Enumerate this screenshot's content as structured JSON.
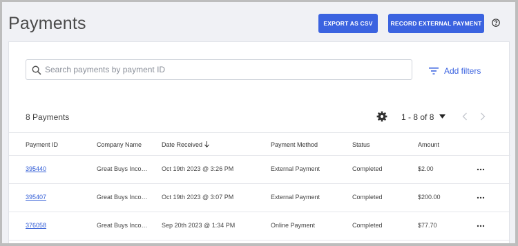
{
  "header": {
    "title": "Payments",
    "export_label": "EXPORT AS CSV",
    "record_label": "RECORD EXTERNAL PAYMENT",
    "help_icon": "help-circle-icon"
  },
  "colors": {
    "accent": "#3b63e0",
    "link": "#2f5bd6",
    "background": "#f0f1f5"
  },
  "search": {
    "placeholder": "Search payments by payment ID",
    "value": "",
    "icon": "search-icon"
  },
  "filters": {
    "label": "Add filters",
    "icon": "filter-icon"
  },
  "summary": {
    "count_label": "8 Payments"
  },
  "pager": {
    "range": "1 - 8 of 8",
    "settings_icon": "gear-icon",
    "prev_icon": "chevron-left-icon",
    "next_icon": "chevron-right-icon"
  },
  "table": {
    "columns": [
      "Payment ID",
      "Company Name",
      "Date Received",
      "Payment Method",
      "Status",
      "Amount"
    ],
    "sort_icon": "arrow-down-icon",
    "rows": [
      [
        "395440",
        "Great Buys Inco…",
        "Oct 19th 2023 @ 3:26 PM",
        "External Payment",
        "Completed",
        "$2.00"
      ],
      [
        "395407",
        "Great Buys Inco…",
        "Oct 19th 2023 @ 3:07 PM",
        "External Payment",
        "Completed",
        "$200.00"
      ],
      [
        "376058",
        "Great Buys Inco…",
        "Sep 20th 2023 @ 1:34 PM",
        "Online Payment",
        "Completed",
        "$77.70"
      ]
    ]
  }
}
